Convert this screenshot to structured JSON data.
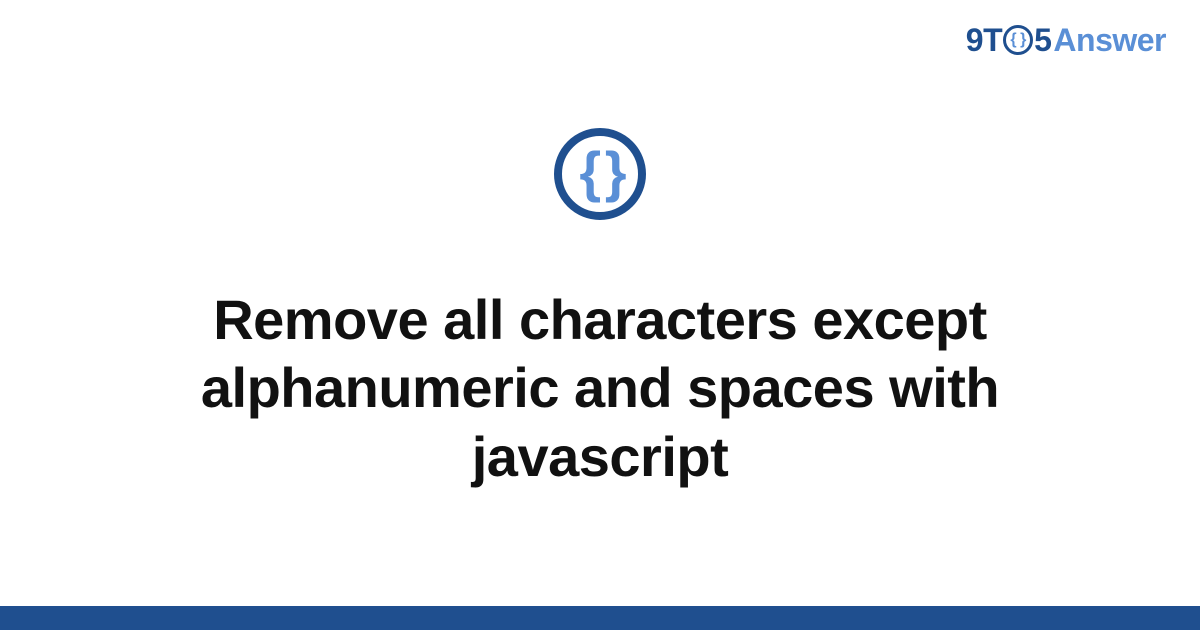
{
  "logo": {
    "part1": "9",
    "part2": "T",
    "o_inner": "{ }",
    "part3": "5",
    "part4": "Answer"
  },
  "icon": {
    "glyph": "{ }"
  },
  "title": "Remove all characters except alphanumeric and spaces with javascript",
  "colors": {
    "brand_dark": "#1f4f8f",
    "brand_light": "#5a8fd6"
  }
}
